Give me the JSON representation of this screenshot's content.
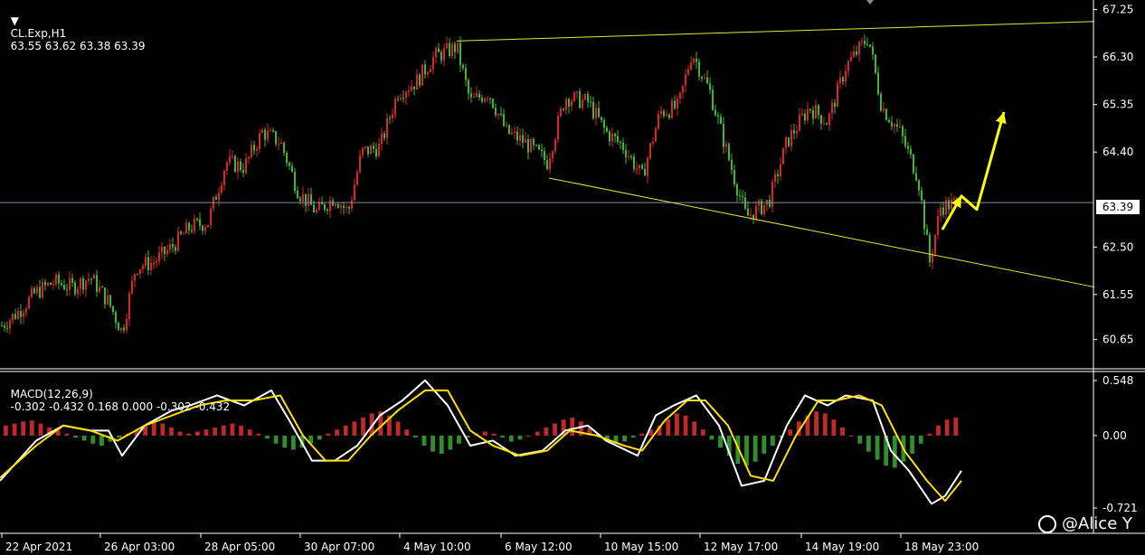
{
  "chart_data": [
    {
      "type": "candlestick",
      "symbol": "CL.Exp,H1",
      "ohlc_text": "63.55 63.62 63.38 63.39",
      "yaxis_ticks": [
        "67.25",
        "66.30",
        "65.35",
        "64.40",
        "63.39",
        "62.50",
        "61.55",
        "60.65"
      ],
      "ylim": [
        60.3,
        67.35
      ],
      "current_price": 63.39,
      "xaxis_ticks": [
        "22 Apr 2021",
        "26 Apr 03:00",
        "28 Apr 05:00",
        "30 Apr 07:00",
        "4 May 10:00",
        "6 May 12:00",
        "10 May 15:00",
        "12 May 17:00",
        "14 May 19:00",
        "18 May 23:00"
      ],
      "price_path": [
        [
          0,
          60.9
        ],
        [
          20,
          61.2
        ],
        [
          40,
          61.6
        ],
        [
          60,
          61.8
        ],
        [
          80,
          61.7
        ],
        [
          100,
          61.9
        ],
        [
          120,
          61.4
        ],
        [
          135,
          60.8
        ],
        [
          150,
          62.1
        ],
        [
          170,
          62.2
        ],
        [
          190,
          62.5
        ],
        [
          210,
          62.9
        ],
        [
          230,
          63.0
        ],
        [
          250,
          64.2
        ],
        [
          270,
          64.1
        ],
        [
          290,
          64.8
        ],
        [
          310,
          64.6
        ],
        [
          330,
          63.6
        ],
        [
          350,
          63.2
        ],
        [
          370,
          63.5
        ],
        [
          385,
          63.2
        ],
        [
          400,
          64.4
        ],
        [
          420,
          64.5
        ],
        [
          440,
          65.6
        ],
        [
          460,
          65.8
        ],
        [
          480,
          66.3
        ],
        [
          505,
          66.5
        ],
        [
          520,
          65.4
        ],
        [
          540,
          65.6
        ],
        [
          560,
          64.8
        ],
        [
          580,
          64.6
        ],
        [
          605,
          64.2
        ],
        [
          625,
          65.5
        ],
        [
          650,
          65.4
        ],
        [
          670,
          64.8
        ],
        [
          690,
          64.5
        ],
        [
          710,
          63.9
        ],
        [
          730,
          65.2
        ],
        [
          750,
          65.3
        ],
        [
          765,
          66.4
        ],
        [
          785,
          65.6
        ],
        [
          810,
          64.0
        ],
        [
          825,
          63.1
        ],
        [
          850,
          63.4
        ],
        [
          870,
          64.6
        ],
        [
          895,
          65.3
        ],
        [
          915,
          65.0
        ],
        [
          935,
          66.1
        ],
        [
          960,
          66.7
        ],
        [
          975,
          65.3
        ],
        [
          995,
          64.8
        ],
        [
          1015,
          63.9
        ],
        [
          1028,
          62.2
        ],
        [
          1040,
          63.3
        ],
        [
          1060,
          63.39
        ]
      ],
      "trendlines": [
        {
          "from": [
            505,
            66.62
          ],
          "to": [
            1210,
            67.01
          ],
          "color": "#e6e62e"
        },
        {
          "from": [
            607,
            63.88
          ],
          "to": [
            1210,
            61.7
          ],
          "color": "#e6e62e"
        }
      ],
      "arrows": [
        {
          "points": [
            [
              1042,
              62.85
            ],
            [
              1063,
              63.52
            ],
            [
              1080,
              63.25
            ],
            [
              1110,
              65.2
            ]
          ],
          "color": "#ffff00"
        }
      ],
      "colors": {
        "bull": "#d9271f",
        "bear": "#3cba2a",
        "trendline": "#e6e62e",
        "arrow": "#ffff00",
        "grid_line": "#7f8fa6"
      }
    },
    {
      "type": "line",
      "name": "MACD(12,26,9)",
      "values_text": "-0.302 -0.432 0.168 0.000 -0.302 -0.432",
      "yaxis_ticks": [
        "0.548",
        "0.00",
        "-0.721"
      ],
      "ylim": [
        -0.721,
        0.548
      ],
      "series": [
        {
          "label": "MACD",
          "color": "#ffffff",
          "values": [
            [
              0,
              -0.45
            ],
            [
              40,
              -0.05
            ],
            [
              70,
              0.1
            ],
            [
              100,
              0.05
            ],
            [
              120,
              0.05
            ],
            [
              135,
              -0.2
            ],
            [
              160,
              0.1
            ],
            [
              190,
              0.25
            ],
            [
              210,
              0.3
            ],
            [
              240,
              0.4
            ],
            [
              270,
              0.3
            ],
            [
              300,
              0.45
            ],
            [
              320,
              0.15
            ],
            [
              345,
              -0.25
            ],
            [
              370,
              -0.25
            ],
            [
              395,
              -0.1
            ],
            [
              420,
              0.2
            ],
            [
              445,
              0.35
            ],
            [
              470,
              0.55
            ],
            [
              495,
              0.3
            ],
            [
              520,
              -0.1
            ],
            [
              545,
              -0.05
            ],
            [
              570,
              -0.2
            ],
            [
              600,
              -0.15
            ],
            [
              625,
              0.05
            ],
            [
              650,
              0.1
            ],
            [
              670,
              -0.05
            ],
            [
              705,
              -0.2
            ],
            [
              725,
              0.2
            ],
            [
              745,
              0.3
            ],
            [
              770,
              0.4
            ],
            [
              795,
              0.1
            ],
            [
              820,
              -0.5
            ],
            [
              845,
              -0.45
            ],
            [
              870,
              0.1
            ],
            [
              890,
              0.4
            ],
            [
              915,
              0.3
            ],
            [
              935,
              0.4
            ],
            [
              965,
              0.35
            ],
            [
              985,
              -0.15
            ],
            [
              1005,
              -0.35
            ],
            [
              1030,
              -0.68
            ],
            [
              1045,
              -0.6
            ],
            [
              1063,
              -0.35
            ]
          ]
        },
        {
          "label": "Signal",
          "color": "#ffe000",
          "values": [
            [
              0,
              -0.42
            ],
            [
              40,
              -0.1
            ],
            [
              70,
              0.1
            ],
            [
              100,
              0.05
            ],
            [
              130,
              -0.05
            ],
            [
              160,
              0.1
            ],
            [
              190,
              0.2
            ],
            [
              220,
              0.3
            ],
            [
              250,
              0.35
            ],
            [
              280,
              0.35
            ],
            [
              310,
              0.4
            ],
            [
              335,
              0.0
            ],
            [
              360,
              -0.25
            ],
            [
              385,
              -0.25
            ],
            [
              410,
              0.0
            ],
            [
              440,
              0.25
            ],
            [
              470,
              0.45
            ],
            [
              495,
              0.45
            ],
            [
              520,
              0.05
            ],
            [
              545,
              -0.1
            ],
            [
              575,
              -0.2
            ],
            [
              605,
              -0.15
            ],
            [
              630,
              0.05
            ],
            [
              660,
              0.0
            ],
            [
              690,
              -0.1
            ],
            [
              710,
              -0.15
            ],
            [
              735,
              0.15
            ],
            [
              760,
              0.35
            ],
            [
              780,
              0.35
            ],
            [
              805,
              0.1
            ],
            [
              830,
              -0.4
            ],
            [
              855,
              -0.45
            ],
            [
              880,
              0.0
            ],
            [
              905,
              0.35
            ],
            [
              925,
              0.35
            ],
            [
              950,
              0.4
            ],
            [
              975,
              0.3
            ],
            [
              1000,
              -0.15
            ],
            [
              1025,
              -0.45
            ],
            [
              1045,
              -0.65
            ],
            [
              1063,
              -0.45
            ]
          ]
        }
      ],
      "histogram": [
        0.1,
        0.12,
        0.14,
        0.15,
        0.12,
        0.08,
        0.05,
        0.02,
        -0.02,
        -0.05,
        -0.08,
        -0.1,
        -0.06,
        -0.02,
        0.02,
        0.06,
        0.1,
        0.14,
        0.12,
        0.08,
        0.04,
        0.02,
        0.04,
        0.06,
        0.08,
        0.1,
        0.12,
        0.1,
        0.06,
        0.02,
        -0.03,
        -0.08,
        -0.12,
        -0.14,
        -0.12,
        -0.08,
        -0.04,
        0.02,
        0.06,
        0.1,
        0.14,
        0.18,
        0.22,
        0.24,
        0.2,
        0.14,
        0.06,
        -0.02,
        -0.1,
        -0.16,
        -0.18,
        -0.14,
        -0.08,
        -0.02,
        0.02,
        0.04,
        0.02,
        -0.02,
        -0.06,
        -0.04,
        0.0,
        0.04,
        0.08,
        0.12,
        0.16,
        0.18,
        0.14,
        0.08,
        0.02,
        -0.04,
        -0.08,
        -0.06,
        -0.02,
        0.02,
        0.06,
        0.1,
        0.16,
        0.22,
        0.2,
        0.14,
        0.06,
        -0.04,
        -0.12,
        -0.2,
        -0.28,
        -0.3,
        -0.26,
        -0.18,
        -0.1,
        -0.02,
        0.06,
        0.14,
        0.2,
        0.24,
        0.22,
        0.16,
        0.08,
        0.0,
        -0.08,
        -0.16,
        -0.24,
        -0.3,
        -0.32,
        -0.26,
        -0.18,
        -0.08,
        0.02,
        0.1,
        0.16,
        0.18
      ],
      "colors": {
        "pos": "#c0282a",
        "neg": "#2f8f2a"
      }
    }
  ],
  "watermark": "@Alice Y"
}
